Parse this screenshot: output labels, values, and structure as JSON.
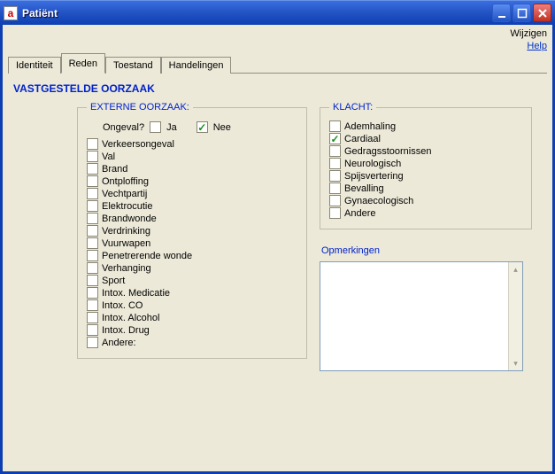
{
  "window": {
    "title": "Patiënt"
  },
  "topLinks": {
    "wijzigen": "Wijzigen",
    "help": "Help"
  },
  "tabs": [
    {
      "label": "Identiteit",
      "active": false
    },
    {
      "label": "Reden",
      "active": true
    },
    {
      "label": "Toestand",
      "active": false
    },
    {
      "label": "Handelingen",
      "active": false
    }
  ],
  "heading": "VASTGESTELDE OORZAAK",
  "externalCause": {
    "legend": "EXTERNE OORZAAK:",
    "accidentLabel": "Ongeval?",
    "yes": {
      "label": "Ja",
      "checked": false
    },
    "no": {
      "label": "Nee",
      "checked": true
    },
    "items": [
      {
        "label": "Verkeersongeval",
        "checked": false
      },
      {
        "label": "Val",
        "checked": false
      },
      {
        "label": "Brand",
        "checked": false
      },
      {
        "label": "Ontploffing",
        "checked": false
      },
      {
        "label": "Vechtpartij",
        "checked": false
      },
      {
        "label": "Elektrocutie",
        "checked": false
      },
      {
        "label": "Brandwonde",
        "checked": false
      },
      {
        "label": "Verdrinking",
        "checked": false
      },
      {
        "label": "Vuurwapen",
        "checked": false
      },
      {
        "label": "Penetrerende wonde",
        "checked": false
      },
      {
        "label": "Verhanging",
        "checked": false
      },
      {
        "label": "Sport",
        "checked": false
      },
      {
        "label": "Intox. Medicatie",
        "checked": false
      },
      {
        "label": "Intox. CO",
        "checked": false
      },
      {
        "label": "Intox. Alcohol",
        "checked": false
      },
      {
        "label": "Intox. Drug",
        "checked": false
      },
      {
        "label": "Andere:",
        "checked": false
      }
    ]
  },
  "complaint": {
    "legend": "KLACHT:",
    "items": [
      {
        "label": "Ademhaling",
        "checked": false
      },
      {
        "label": "Cardiaal",
        "checked": true
      },
      {
        "label": "Gedragsstoornissen",
        "checked": false
      },
      {
        "label": "Neurologisch",
        "checked": false
      },
      {
        "label": "Spijsvertering",
        "checked": false
      },
      {
        "label": "Bevalling",
        "checked": false
      },
      {
        "label": "Gynaecologisch",
        "checked": false
      },
      {
        "label": "Andere",
        "checked": false
      }
    ]
  },
  "remarks": {
    "label": "Opmerkingen",
    "value": ""
  }
}
